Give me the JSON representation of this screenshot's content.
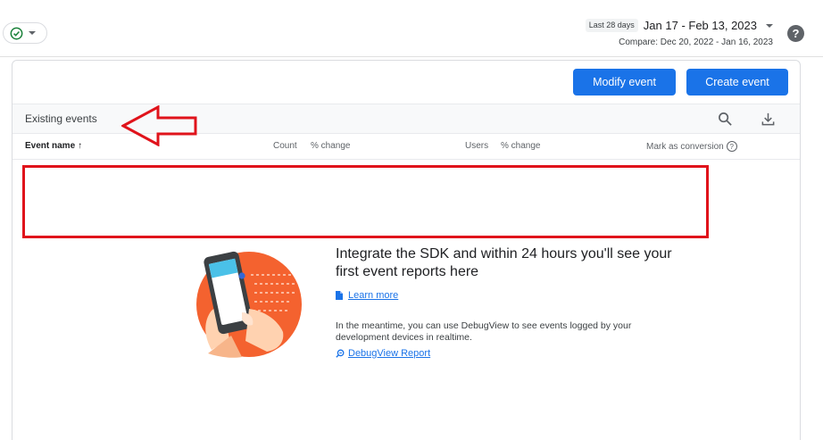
{
  "header": {
    "date_badge": "Last 28 days",
    "date_range": "Jan 17 - Feb 13, 2023",
    "compare": "Compare: Dec 20, 2022 - Jan 16, 2023",
    "help_icon": "help-icon",
    "help_glyph": "?"
  },
  "toolbar": {
    "modify_label": "Modify event",
    "create_label": "Create event"
  },
  "section": {
    "title": "Existing events"
  },
  "table": {
    "columns": [
      "Event name",
      "Count",
      "% change",
      "Users",
      "% change",
      "Mark as conversion"
    ],
    "sort_glyph": "↑",
    "conversion_help_glyph": "?"
  },
  "empty_state": {
    "heading": "Integrate the SDK and within 24 hours you'll see your first event reports here",
    "learn_more": "Learn more",
    "meantime": "In the meantime, you can use DebugView to see events logged by your development devices in realtime.",
    "debugview_link": "DebugView Report"
  },
  "colors": {
    "primary": "#1a73e8",
    "annotation": "#e0131b",
    "illustration_orange": "#f4622f",
    "status_green": "#188038"
  }
}
